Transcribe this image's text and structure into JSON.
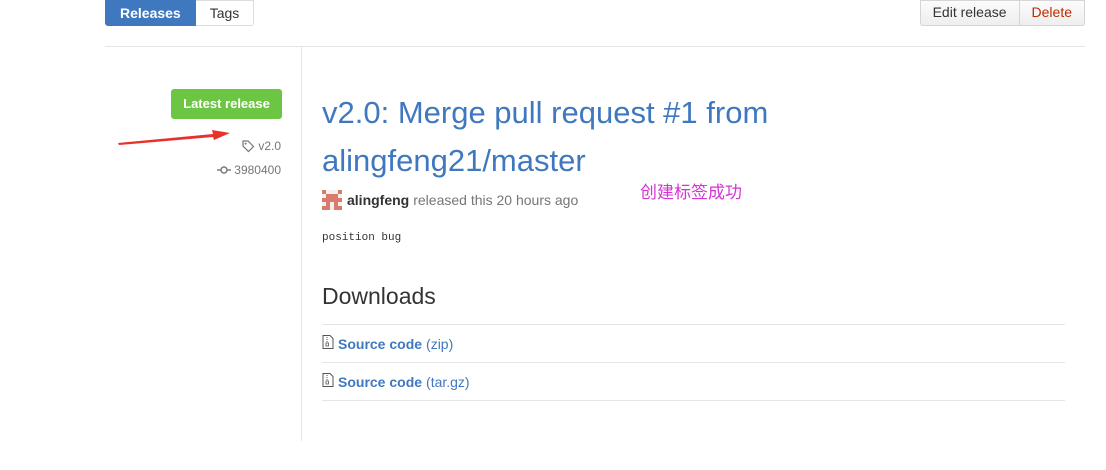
{
  "tabs": [
    {
      "label": "Releases",
      "active": true
    },
    {
      "label": "Tags",
      "active": false
    }
  ],
  "actions": {
    "edit": "Edit release",
    "delete": "Delete"
  },
  "sidebar": {
    "badge": "Latest release",
    "tag": "v2.0",
    "commit": "3980400"
  },
  "release": {
    "title": "v2.0: Merge pull request #1 from alingfeng21/master",
    "author": "alingfeng",
    "released_text": "released this 20 hours ago",
    "body": "position bug"
  },
  "annotation": "创建标签成功",
  "downloads": {
    "heading": "Downloads",
    "items": [
      {
        "name": "Source code",
        "ext": "(zip)"
      },
      {
        "name": "Source code",
        "ext": "(tar.gz)"
      }
    ]
  },
  "colors": {
    "accent": "#4078c0",
    "badge": "#6cc644",
    "delete": "#bd2c00",
    "annotation": "#d633d6",
    "arrow": "#e8312a"
  }
}
